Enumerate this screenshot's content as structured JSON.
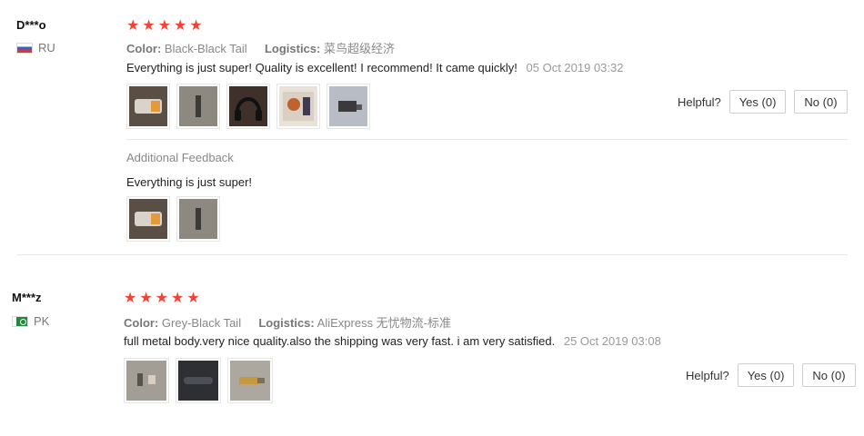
{
  "reviews": [
    {
      "user": "D***o",
      "country": "RU",
      "rating": 5,
      "color_label": "Color:",
      "color_value": "Black-Black Tail",
      "logistics_label": "Logistics:",
      "logistics_value": "菜鸟超级经济",
      "text": "Everything is just super! Quality is excellent! I recommend! It came quickly!",
      "date": "05 Oct 2019 03:32",
      "photos": [
        {
          "icon": "photo-thumbnail",
          "color": "#6b5a4a"
        },
        {
          "icon": "photo-thumbnail",
          "color": "#8d8880"
        },
        {
          "icon": "photo-thumbnail",
          "color": "#4a3c34"
        },
        {
          "icon": "photo-thumbnail",
          "color": "#c88a5a"
        },
        {
          "icon": "photo-thumbnail",
          "color": "#aeb4bf"
        }
      ],
      "helpful_label": "Helpful?",
      "yes_label": "Yes (0)",
      "no_label": "No (0)",
      "additional_feedback_label": "Additional Feedback",
      "additional_text": "Everything is just super!",
      "additional_photos": [
        {
          "icon": "photo-thumbnail",
          "color": "#6b5a4a"
        },
        {
          "icon": "photo-thumbnail",
          "color": "#8d8880"
        }
      ]
    },
    {
      "user": "M***z",
      "country": "PK",
      "rating": 5,
      "color_label": "Color:",
      "color_value": "Grey-Black Tail",
      "logistics_label": "Logistics:",
      "logistics_value": "AliExpress 无忧物流-标准",
      "text": "full metal body.very nice quality.also the shipping was very fast. i am very satisfied.",
      "date": "25 Oct 2019 03:08",
      "photos": [
        {
          "icon": "photo-thumbnail",
          "color": "#9a948b"
        },
        {
          "icon": "photo-thumbnail",
          "color": "#2e2f33"
        },
        {
          "icon": "photo-thumbnail",
          "color": "#a9a59c"
        }
      ],
      "helpful_label": "Helpful?",
      "yes_label": "Yes (0)",
      "no_label": "No (0)"
    }
  ],
  "colors": {
    "star": "#f44336",
    "muted_text": "#888888",
    "divider": "#e8e8e8"
  }
}
